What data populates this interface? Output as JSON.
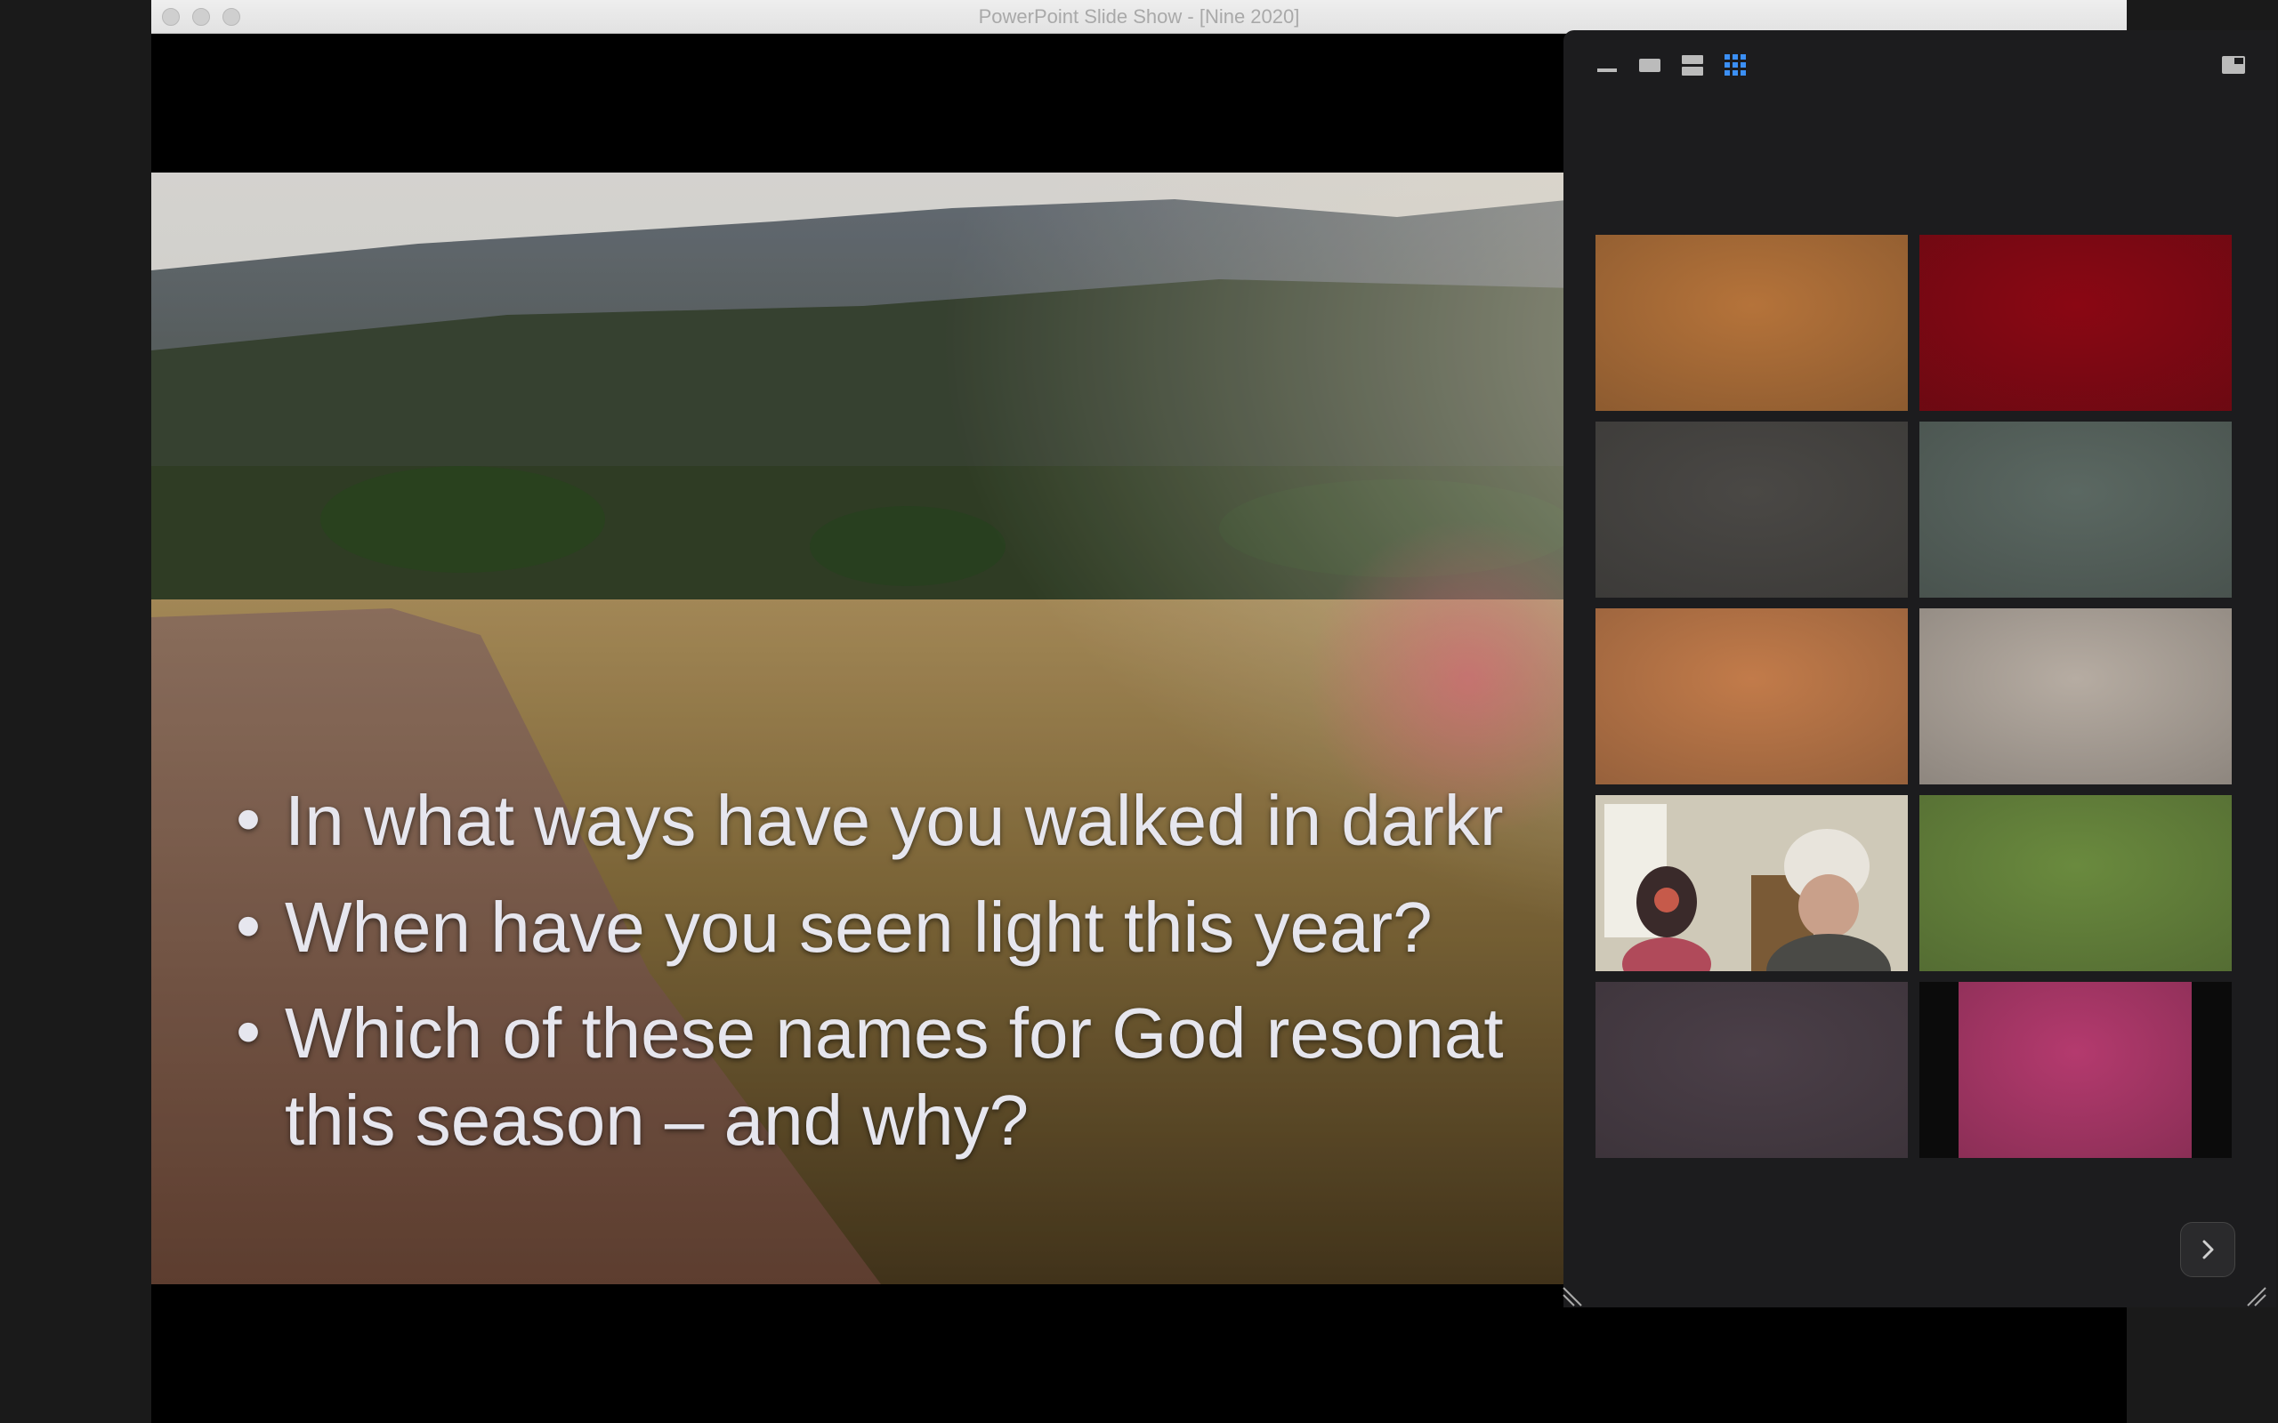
{
  "window": {
    "title": "PowerPoint Slide Show - [Nine 2020]"
  },
  "slide": {
    "bullets": [
      "In what ways have you walked in darkr",
      "When have you seen light this year?",
      "Which of these names for God resonat",
      "this season – and why?"
    ],
    "bullet_glyph": "•"
  },
  "gallery": {
    "view_buttons": [
      "minimize-video-icon",
      "speaker-view-icon",
      "two-row-view-icon",
      "grid-view-icon"
    ],
    "active_view": "grid-view-icon",
    "tiles": [
      {
        "name": "participant-tile-1",
        "color": "#b5733a"
      },
      {
        "name": "participant-tile-2",
        "color": "#8a0713"
      },
      {
        "name": "participant-tile-3",
        "color": "#4a4845"
      },
      {
        "name": "participant-tile-4",
        "color": "#5b6862"
      },
      {
        "name": "participant-tile-5",
        "color": "#c27b4a"
      },
      {
        "name": "participant-tile-6",
        "color": "#b6aca2"
      },
      {
        "name": "participant-tile-7",
        "color": "#8d8c7a",
        "has_people": true
      },
      {
        "name": "participant-tile-8",
        "color": "#6a8a3e"
      },
      {
        "name": "participant-tile-9",
        "color": "#4b3f48"
      },
      {
        "name": "participant-tile-10",
        "color": "#b43a6e",
        "letterboxed": true
      }
    ],
    "next_icon": "chevron-right-icon"
  }
}
